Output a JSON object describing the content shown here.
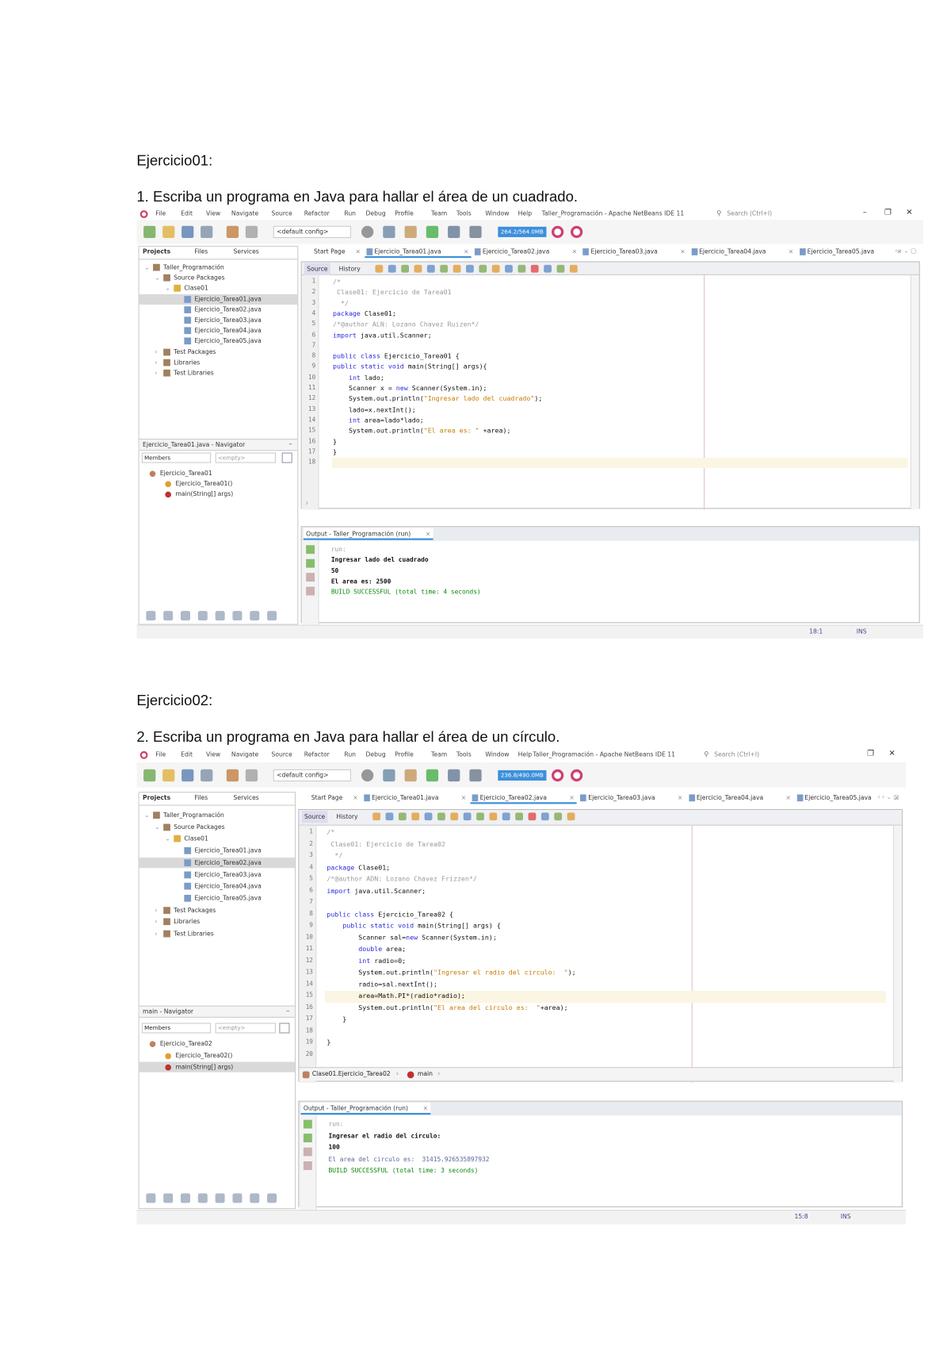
{
  "document": {
    "ex1_heading": "Ejercicio01:",
    "ex1_prompt": "1. Escriba un programa en Java para hallar el área de un cuadrado.",
    "ex2_heading": "Ejercicio02:",
    "ex2_prompt": "2. Escriba un programa en Java para hallar el área de un círculo."
  },
  "colors": {
    "accent": "#3c8fdc",
    "selection": "#d9d9d9",
    "current_line": "#fbf5e3",
    "panel_bg": "#f2f2f2",
    "build_success": "#0a8a0a"
  },
  "ides": [
    {
      "title": "Taller_Programación - Apache NetBeans IDE 11",
      "search_placeholder": "Search (Ctrl+I)",
      "window_controls": [
        "–",
        "❐",
        "✕"
      ],
      "menu": [
        "File",
        "Edit",
        "View",
        "Navigate",
        "Source",
        "Refactor",
        "Run",
        "Debug",
        "Profile",
        "Team",
        "Tools",
        "Window",
        "Help"
      ],
      "toolbar_icons": [
        {
          "name": "new-project-icon",
          "color": "#6aa84f"
        },
        {
          "name": "new-file-icon",
          "color": "#e0b040"
        },
        {
          "name": "open-project-icon",
          "color": "#5a7fb0"
        },
        {
          "name": "save-all-icon",
          "color": "#8090a8"
        },
        {
          "name": "undo-icon",
          "color": "#c08040"
        },
        {
          "name": "redo-icon",
          "color": "#a0a0a0"
        }
      ],
      "config": "<default config>",
      "run_icons": [
        {
          "name": "globe-icon",
          "color": "#777"
        },
        {
          "name": "build-hammer-icon",
          "color": "#6080a0"
        },
        {
          "name": "clean-build-icon",
          "color": "#c09050"
        },
        {
          "name": "run-icon",
          "color": "#3aa83a"
        },
        {
          "name": "debug-icon",
          "color": "#5a7090"
        },
        {
          "name": "profile-icon",
          "color": "#607080"
        }
      ],
      "memory": "264.2/564.0MB",
      "gc_icons": [
        {
          "name": "gc-icon",
          "color": "#d04070"
        },
        {
          "name": "profiler-icon",
          "color": "#d04070"
        }
      ],
      "panel_tabs": [
        "Projects",
        "Files",
        "Services"
      ],
      "tree": [
        {
          "label": "Taller_Programación",
          "depth": 0,
          "icon": "project-icon"
        },
        {
          "label": "Source Packages",
          "depth": 1,
          "icon": "package-folder-icon"
        },
        {
          "label": "Clase01",
          "depth": 2,
          "icon": "package-icon"
        },
        {
          "label": "Ejercicio_Tarea01.java",
          "depth": 3,
          "icon": "java-file-icon",
          "selected": true
        },
        {
          "label": "Ejercicio_Tarea02.java",
          "depth": 3,
          "icon": "java-file-icon"
        },
        {
          "label": "Ejercicio_Tarea03.java",
          "depth": 3,
          "icon": "java-file-icon"
        },
        {
          "label": "Ejercicio_Tarea04.java",
          "depth": 3,
          "icon": "java-file-icon"
        },
        {
          "label": "Ejercicio_Tarea05.java",
          "depth": 3,
          "icon": "java-file-icon"
        },
        {
          "label": "Test Packages",
          "depth": 1,
          "icon": "folder-icon"
        },
        {
          "label": "Libraries",
          "depth": 1,
          "icon": "library-icon"
        },
        {
          "label": "Test Libraries",
          "depth": 1,
          "icon": "library-icon"
        }
      ],
      "navigator_title": "Ejercicio_Tarea01.java - Navigator",
      "navigator_members": "Members",
      "navigator_filter": "<empty>",
      "navigator_tree": [
        {
          "label": "Ejercicio_Tarea01",
          "depth": 0
        },
        {
          "label": "Ejercicio_Tarea01()",
          "depth": 1
        },
        {
          "label": "main(String[] args)",
          "depth": 1
        }
      ],
      "editor_tabs": [
        {
          "label": "Start Page"
        },
        {
          "label": "Ejercicio_Tarea01.java",
          "active": true
        },
        {
          "label": "Ejercicio_Tarea02.java"
        },
        {
          "label": "Ejercicio_Tarea03.java"
        },
        {
          "label": "Ejercicio_Tarea04.java"
        },
        {
          "label": "Ejercicio_Tarea05.java"
        }
      ],
      "source_tab": "Source",
      "history_tab": "History",
      "code": [
        "/*",
        " Clase01: Ejercicio de Tarea01",
        "  */",
        "package Clase01;",
        "/*@author ALN: Lozano Chavez Ruizen*/",
        "import java.util.Scanner;",
        "",
        "public class Ejercicio_Tarea01 {",
        "public static void main(String[] args){",
        "    int lado;",
        "    Scanner x = new Scanner(System.in);",
        "    System.out.println(\"Ingresar lado del cuadrado\");",
        "    lado=x.nextInt();",
        "    int area=lado*lado;",
        "    System.out.println(\"El area es: \" +area);",
        "}",
        "}",
        ""
      ],
      "current_line": 18,
      "breadcrumb": [],
      "output_title": "Output - Taller_Programación (run)",
      "output": [
        {
          "text": "run:",
          "kind": "dim"
        },
        {
          "text": "Ingresar lado del cuadrado",
          "kind": "normal"
        },
        {
          "text": "50",
          "kind": "normal"
        },
        {
          "text": "El area es: 2500",
          "kind": "normal"
        },
        {
          "text": "BUILD SUCCESSFUL (total time: 4 seconds)",
          "kind": "success"
        }
      ],
      "status_position": "18:1",
      "status_mode": "INS"
    },
    {
      "title": "Taller_Programación - Apache NetBeans IDE 11",
      "search_placeholder": "Search (Ctrl+I)",
      "window_controls": [
        "❐",
        "✕"
      ],
      "menu": [
        "File",
        "Edit",
        "View",
        "Navigate",
        "Source",
        "Refactor",
        "Run",
        "Debug",
        "Profile",
        "Team",
        "Tools",
        "Window",
        "Help"
      ],
      "toolbar_icons": [
        {
          "name": "new-project-icon",
          "color": "#6aa84f"
        },
        {
          "name": "new-file-icon",
          "color": "#e0b040"
        },
        {
          "name": "open-project-icon",
          "color": "#5a7fb0"
        },
        {
          "name": "save-all-icon",
          "color": "#8090a8"
        },
        {
          "name": "undo-icon",
          "color": "#c08040"
        },
        {
          "name": "redo-icon",
          "color": "#a0a0a0"
        }
      ],
      "config": "<default config>",
      "run_icons": [
        {
          "name": "globe-icon",
          "color": "#777"
        },
        {
          "name": "build-hammer-icon",
          "color": "#6080a0"
        },
        {
          "name": "clean-build-icon",
          "color": "#c09050"
        },
        {
          "name": "run-icon",
          "color": "#3aa83a"
        },
        {
          "name": "debug-icon",
          "color": "#5a7090"
        },
        {
          "name": "profile-icon",
          "color": "#607080"
        }
      ],
      "memory": "236.8/490.0MB",
      "gc_icons": [
        {
          "name": "gc-icon",
          "color": "#d04070"
        },
        {
          "name": "profiler-icon",
          "color": "#d04070"
        }
      ],
      "panel_tabs": [
        "Projects",
        "Files",
        "Services"
      ],
      "tree": [
        {
          "label": "Taller_Programación",
          "depth": 0,
          "icon": "project-icon"
        },
        {
          "label": "Source Packages",
          "depth": 1,
          "icon": "package-folder-icon"
        },
        {
          "label": "Clase01",
          "depth": 2,
          "icon": "package-icon"
        },
        {
          "label": "Ejercicio_Tarea01.java",
          "depth": 3,
          "icon": "java-file-icon"
        },
        {
          "label": "Ejercicio_Tarea02.java",
          "depth": 3,
          "icon": "java-file-icon",
          "selected": true
        },
        {
          "label": "Ejercicio_Tarea03.java",
          "depth": 3,
          "icon": "java-file-icon"
        },
        {
          "label": "Ejercicio_Tarea04.java",
          "depth": 3,
          "icon": "java-file-icon"
        },
        {
          "label": "Ejercicio_Tarea05.java",
          "depth": 3,
          "icon": "java-file-icon"
        },
        {
          "label": "Test Packages",
          "depth": 1,
          "icon": "folder-icon"
        },
        {
          "label": "Libraries",
          "depth": 1,
          "icon": "library-icon"
        },
        {
          "label": "Test Libraries",
          "depth": 1,
          "icon": "library-icon"
        }
      ],
      "navigator_title": "main - Navigator",
      "navigator_members": "Members",
      "navigator_filter": "<empty>",
      "navigator_tree": [
        {
          "label": "Ejercicio_Tarea02",
          "depth": 0
        },
        {
          "label": "Ejercicio_Tarea02()",
          "depth": 1
        },
        {
          "label": "main(String[] args)",
          "depth": 1,
          "selected": true
        }
      ],
      "editor_tabs": [
        {
          "label": "Start Page"
        },
        {
          "label": "Ejercicio_Tarea01.java"
        },
        {
          "label": "Ejercicio_Tarea02.java",
          "active": true
        },
        {
          "label": "Ejercicio_Tarea03.java"
        },
        {
          "label": "Ejercicio_Tarea04.java"
        },
        {
          "label": "Ejercicio_Tarea05.java"
        }
      ],
      "source_tab": "Source",
      "history_tab": "History",
      "code": [
        "/*",
        " Clase01: Ejercicio de Tarea02",
        "  */",
        "package Clase01;",
        "/*@author ADN: Lozano Chavez Frizzen*/",
        "import java.util.Scanner;",
        "",
        "public class Ejercicio_Tarea02 {",
        "    public static void main(String[] args) {",
        "        Scanner sal=new Scanner(System.in);",
        "        double area;",
        "        int radio=0;",
        "        System.out.println(\"Ingresar el radio del circulo:  \");",
        "        radio=sal.nextInt();",
        "        area=Math.PI*(radio*radio);",
        "        System.out.println(\"El area del circulo es:  \"+area);",
        "    }",
        "",
        "}",
        ""
      ],
      "current_line": 15,
      "breadcrumb": [
        "Clase01.Ejercicio_Tarea02",
        "main"
      ],
      "output_title": "Output - Taller_Programación (run)",
      "output": [
        {
          "text": "run:",
          "kind": "dim"
        },
        {
          "text": "Ingresar el radio del circulo:",
          "kind": "normal"
        },
        {
          "text": "100",
          "kind": "normal"
        },
        {
          "text": "El area del circulo es:  31415.926535897932",
          "kind": "info"
        },
        {
          "text": "BUILD SUCCESSFUL (total time: 3 seconds)",
          "kind": "success"
        }
      ],
      "status_position": "15:8",
      "status_mode": "INS"
    }
  ]
}
